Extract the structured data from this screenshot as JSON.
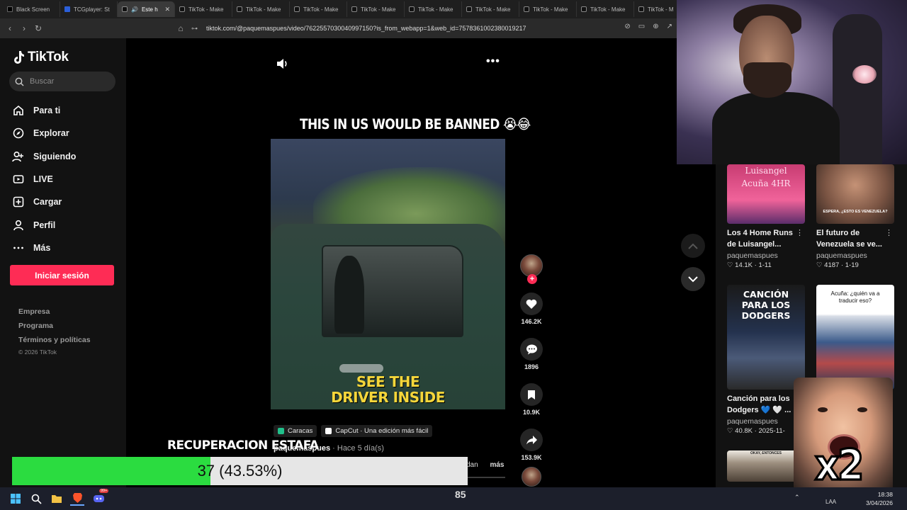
{
  "browser": {
    "tabs": [
      {
        "label": "Black Screen",
        "favicon": "black-screen-favicon"
      },
      {
        "label": "TCGplayer: St",
        "favicon": "tcgplayer-favicon"
      },
      {
        "label": "Este h",
        "favicon": "tiktok-favicon",
        "active": true,
        "audio": true
      },
      {
        "label": "TikTok - Make",
        "favicon": "tiktok-favicon"
      },
      {
        "label": "TikTok - Make",
        "favicon": "tiktok-favicon"
      },
      {
        "label": "TikTok - Make",
        "favicon": "tiktok-favicon"
      },
      {
        "label": "TikTok - Make",
        "favicon": "tiktok-favicon"
      },
      {
        "label": "TikTok - Make",
        "favicon": "tiktok-favicon"
      },
      {
        "label": "TikTok - Make",
        "favicon": "tiktok-favicon"
      },
      {
        "label": "TikTok - Make",
        "favicon": "tiktok-favicon"
      },
      {
        "label": "TikTok - Make",
        "favicon": "tiktok-favicon"
      },
      {
        "label": "TikTok - M",
        "favicon": "tiktok-favicon"
      }
    ],
    "url": "tiktok.com/@paquemaspues/video/7622557030040997150?is_from_webapp=1&web_id=7578361002380019217"
  },
  "sidebar": {
    "logo": "TikTok",
    "search_placeholder": "Buscar",
    "nav": [
      {
        "label": "Para ti",
        "icon": "home-icon"
      },
      {
        "label": "Explorar",
        "icon": "compass-icon"
      },
      {
        "label": "Siguiendo",
        "icon": "following-icon"
      },
      {
        "label": "LIVE",
        "icon": "live-icon"
      },
      {
        "label": "Cargar",
        "icon": "upload-icon"
      },
      {
        "label": "Perfil",
        "icon": "profile-icon"
      },
      {
        "label": "Más",
        "icon": "more-icon"
      }
    ],
    "login_label": "Iniciar sesión",
    "footer": [
      "Empresa",
      "Programa",
      "Términos y políticas"
    ],
    "copyright": "© 2026 TikTok"
  },
  "video": {
    "caption_top": "THIS IN US WOULD BE BANNED 😭😂",
    "overlay_text_line1": "SEE THE",
    "overlay_text_line2": "DRIVER INSIDE",
    "chips": [
      {
        "label": "Caracas",
        "color": "#21c08b"
      },
      {
        "label": "CapCut · Una edición más fácil",
        "color": "#ffffff"
      }
    ],
    "author": "paquemaspues",
    "ago": "· Hace 5 día(s)",
    "desc_tail": "dan",
    "more_label": "más",
    "likes": "146.2K",
    "comments": "1896",
    "saves": "10.9K",
    "shares": "153.9K"
  },
  "recommendations": [
    {
      "title": "Los 4 Home Runs de Luisangel...",
      "author": "paquemaspues",
      "likes": "14.1K",
      "date": "1-11",
      "thumb_text": "Luisangel Acuña 4HR"
    },
    {
      "title": "El futuro de Venezuela se ve...",
      "author": "paquemaspues",
      "likes": "4187",
      "date": "1-19",
      "thumb_text": "ESPERA, ¿ESTO ES VENEZUELA?"
    },
    {
      "title": "Canción para los Dodgers 💙 🤍 ...",
      "author": "paquemaspues",
      "likes": "40.8K",
      "date": "2025-11-",
      "thumb_text": "CANCIÓN PARA LOS DODGERS"
    },
    {
      "title": "",
      "author": "",
      "likes": "",
      "date": "",
      "thumb_text": "Acuña: ¿quién va a traducir eso?"
    },
    {
      "title": "",
      "author": "",
      "likes": "",
      "date": "",
      "thumb_text": "OKAY, ENTONCES"
    }
  ],
  "stream_overlay": {
    "recovery_title": "RECUPERACION ESTAFA",
    "recovery_value": "37 (43.53%)",
    "recovery_fraction": 0.4353,
    "meme_label": "x2"
  },
  "taskbar": {
    "counter": "85",
    "lang": "LAA",
    "time": "18:38",
    "date": "3/04/2026",
    "notification_badge": "99+"
  },
  "colors": {
    "brand_red": "#fe2c55",
    "progress_green": "#2bdc40",
    "overlay_yellow": "#f5d63a"
  }
}
